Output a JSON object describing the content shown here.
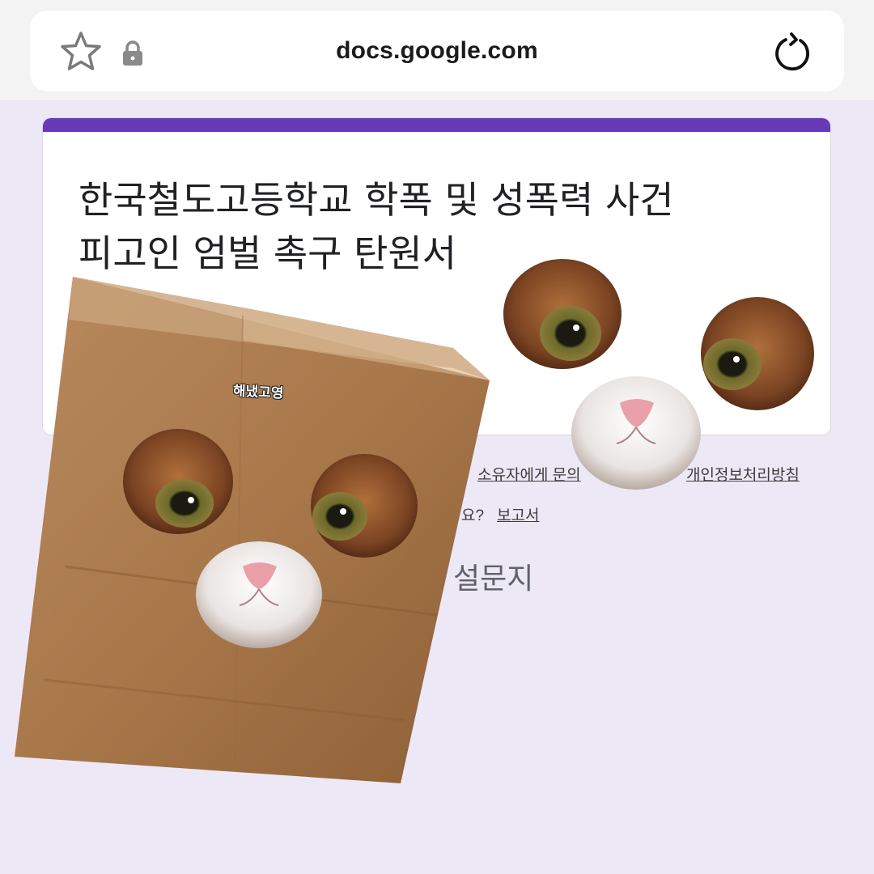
{
  "browser": {
    "url": "docs.google.com",
    "icons": [
      "star-icon",
      "lock-icon",
      "reload-icon"
    ]
  },
  "form": {
    "accent_color": "#673ab7",
    "title_line1": "한국철도고등학교 학폭 및 성폭력 사건",
    "title_line2": "피고인 엄벌 촉구 탄원서"
  },
  "footer": {
    "contact_owner": "소유자에게 문의",
    "privacy_policy": "개인정보처리방침",
    "report_suffix": "요?",
    "report_link": "보고서",
    "brand_partial": "설문지"
  },
  "sticker": {
    "caption": "해냈고영"
  }
}
